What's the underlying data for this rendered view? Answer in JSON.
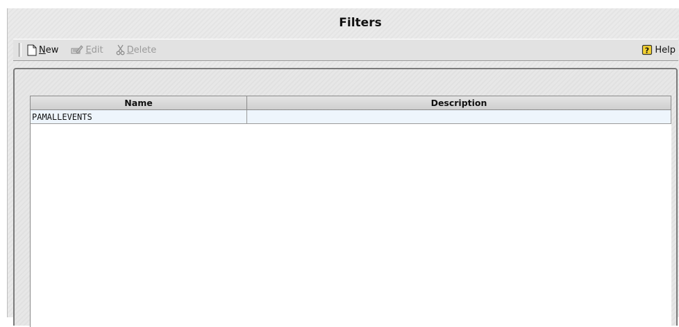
{
  "window": {
    "title": "Filters"
  },
  "toolbar": {
    "new": {
      "mnemonic": "N",
      "rest": "ew",
      "icon": "new-document-icon",
      "enabled": true
    },
    "edit": {
      "mnemonic": "E",
      "rest": "dit",
      "icon": "edit-icon",
      "enabled": false
    },
    "delete": {
      "mnemonic": "D",
      "rest": "elete",
      "icon": "scissors-icon",
      "enabled": false
    },
    "help": {
      "label": "Help",
      "icon": "help-icon"
    }
  },
  "table": {
    "columns": [
      "Name",
      "Description"
    ],
    "rows": [
      {
        "name": "PAMALLEVENTS",
        "description": ""
      }
    ]
  },
  "colors": {
    "row_selected": "#eef5fc",
    "panel": "#e6e6e6"
  }
}
